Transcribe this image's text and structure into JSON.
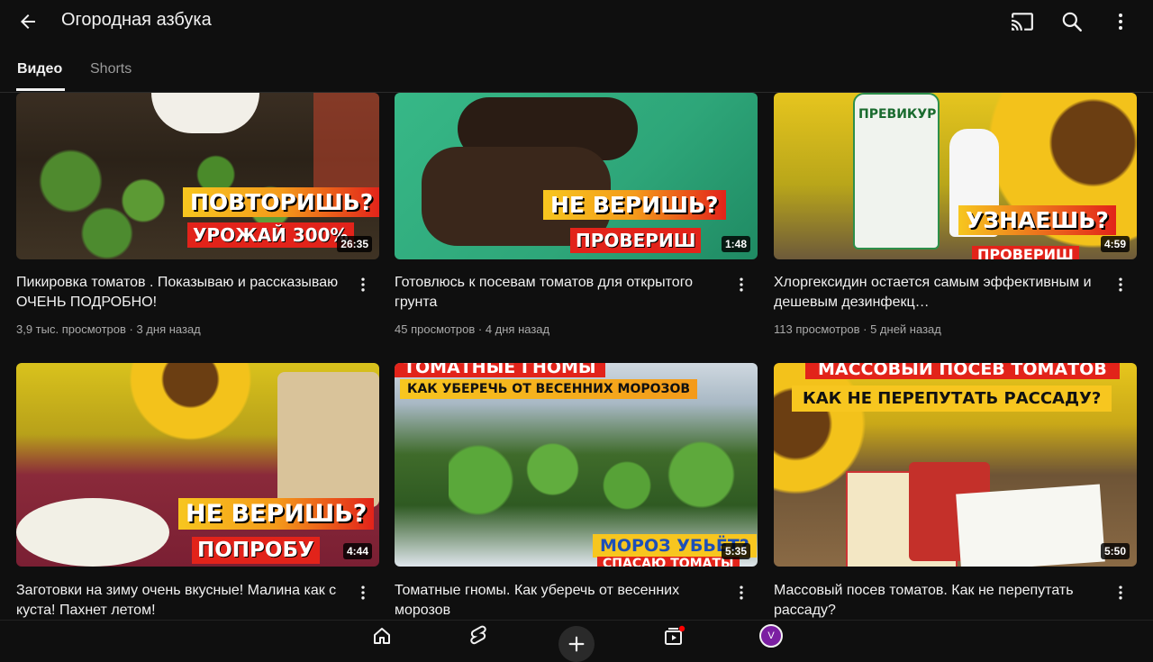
{
  "header": {
    "title": "Огородная азбука",
    "icons": [
      "back-arrow-icon",
      "cast-icon",
      "search-icon",
      "more-vert-icon"
    ]
  },
  "tabs": [
    {
      "label": "Видео",
      "active": true
    },
    {
      "label": "Shorts",
      "active": false
    }
  ],
  "videos": [
    {
      "title": "Пикировка томатов . Показываю и рассказываю ОЧЕНЬ ПОДРОБНО!",
      "meta": "3,9 тыс. просмотров · 3 дня назад",
      "duration": "26:35",
      "thumb_text": [
        "ПОВТОРИШЬ?",
        "УРОЖАЙ 300%"
      ]
    },
    {
      "title": "Готовлюсь к посевам томатов для открытого грунта",
      "meta": "45 просмотров · 4 дня назад",
      "duration": "1:48",
      "thumb_text": [
        "НЕ ВЕРИШЬ?",
        "ПРОВЕРИШ"
      ]
    },
    {
      "title": "Хлоргексидин остается самым эффективным и дешевым дезинфекц…",
      "meta": "113 просмотров · 5 дней назад",
      "duration": "4:59",
      "thumb_text": [
        "УЗНАЕШЬ?",
        "ПРЕВИКУР",
        "ПРОВЕРИШ"
      ]
    },
    {
      "title": "Заготовки на зиму очень вкусные! Малина   как с куста! Пахнет летом!",
      "meta": "",
      "duration": "4:44",
      "thumb_text": [
        "НЕ ВЕРИШЬ?",
        "ПОПРОБУ"
      ]
    },
    {
      "title": "Томатные гномы. Как уберечь от весенних морозов",
      "meta": "",
      "duration": "5:35",
      "thumb_text": [
        "ТОМАТНЫЕ ГНОМЫ",
        "КАК УБЕРЕЧЬ ОТ ВЕСЕННИХ МОРОЗОВ",
        "МОРОЗ УБЬЁТ?",
        "СПАСАЮ ТОМАТЫ"
      ]
    },
    {
      "title": "Массовый посев томатов. Как не перепутать рассаду?",
      "meta": "",
      "duration": "5:50",
      "thumb_text": [
        "МАССОВЫЙ ПОСЕВ ТОМАТОВ",
        "КАК НЕ ПЕРЕПУТАТЬ РАССАДУ?"
      ]
    }
  ],
  "bottom_nav": {
    "items": [
      "home-icon",
      "shorts-icon",
      "create-icon",
      "subscriptions-icon",
      "you-avatar"
    ],
    "avatar_letter": "V",
    "avatar_color": "#7b1fa2",
    "notification_color": "#ff0000"
  },
  "colors": {
    "background": "#0f0f0f",
    "text_primary": "#f1f1f1",
    "text_secondary": "#aaaaaa"
  }
}
